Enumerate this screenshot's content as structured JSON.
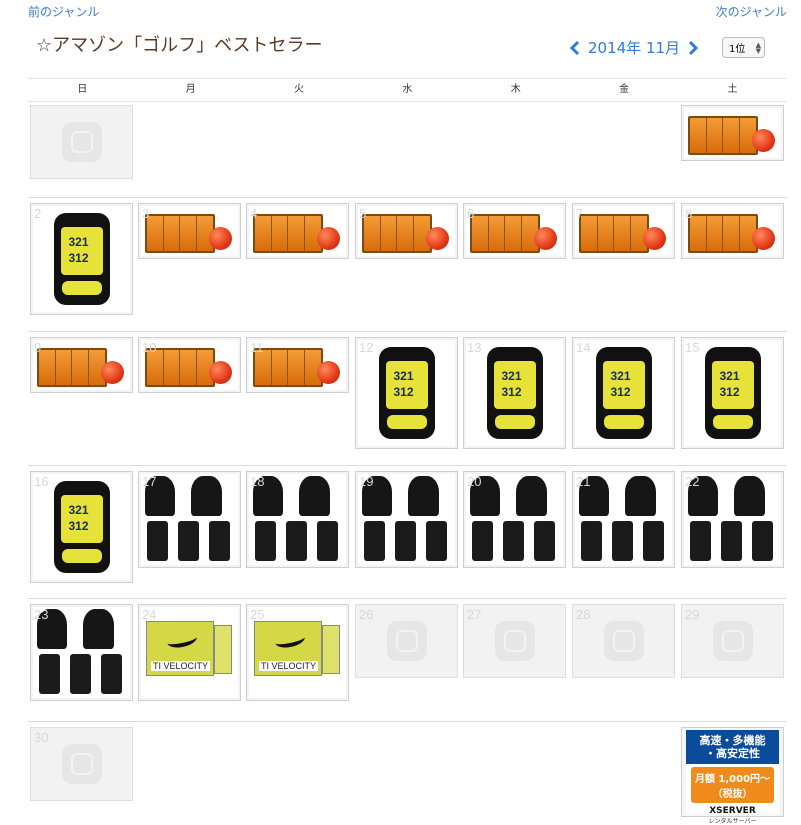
{
  "nav": {
    "prev_genre": "前のジャンル",
    "next_genre": "次のジャンル"
  },
  "header": {
    "title": "☆アマゾン「ゴルフ」ベストセラー",
    "month": "2014年 11月",
    "rank": "1位"
  },
  "weekdays": [
    "日",
    "月",
    "火",
    "水",
    "木",
    "金",
    "土"
  ],
  "days": {
    "d2": "2",
    "d3": "3",
    "d4": "4",
    "d5": "5",
    "d6": "6",
    "d7": "7",
    "d8": "8",
    "d9": "9",
    "d10": "10",
    "d11": "11",
    "d12": "12",
    "d13": "13",
    "d14": "14",
    "d15": "15",
    "d16": "16",
    "d17": "17",
    "d18": "18",
    "d19": "19",
    "d20": "20",
    "d21": "21",
    "d22": "22",
    "d23": "23",
    "d24": "24",
    "d25": "25",
    "d26": "26",
    "d27": "27",
    "d28": "28",
    "d29": "29",
    "d30": "30"
  },
  "ad": {
    "line1": "高速・多機能",
    "line2": "・高安定性",
    "price": "月額 1,000円～（税抜）",
    "logo": "XSERVER",
    "sub": "レンタルサーバー"
  },
  "colors": {
    "link": "#3a7bd5",
    "title": "#5a3a25",
    "accent": "#2f7bd8"
  }
}
